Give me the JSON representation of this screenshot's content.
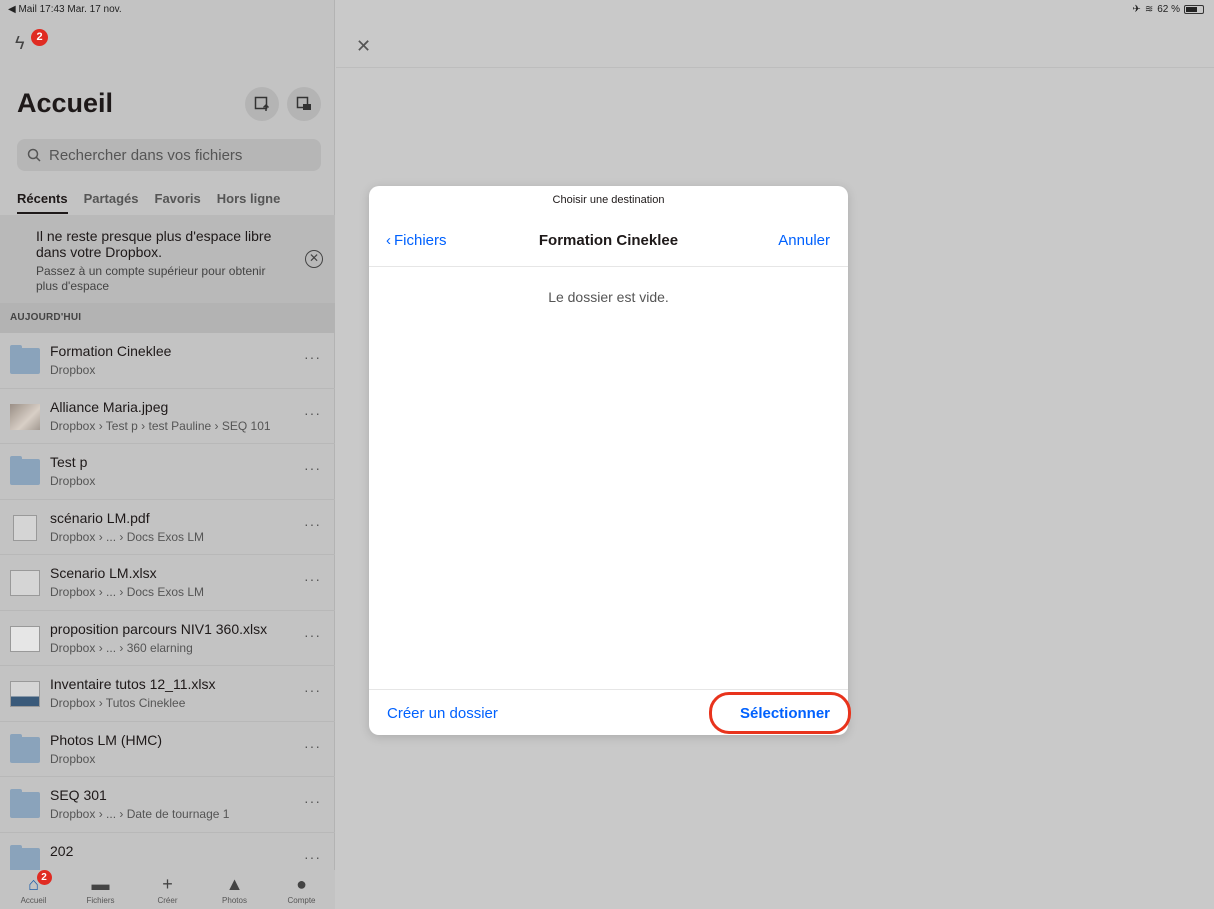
{
  "status_bar": {
    "back_app": "◀ Mail",
    "time": "17:43",
    "date": "Mar. 17 nov.",
    "battery": "62 %"
  },
  "sidebar": {
    "notification_count": "2",
    "title": "Accueil",
    "search_placeholder": "Rechercher dans vos fichiers",
    "tabs": [
      "Récents",
      "Partagés",
      "Favoris",
      "Hors ligne"
    ],
    "banner": {
      "title": "Il ne reste presque plus d'espace libre dans votre Dropbox.",
      "subtitle": "Passez à un compte supérieur pour obtenir plus d'espace"
    },
    "section_label": "AUJOURD'HUI",
    "items": [
      {
        "name": "Formation Cineklee",
        "path": "Dropbox",
        "icon": "folder-icon"
      },
      {
        "name": "Alliance Maria.jpeg",
        "path": "Dropbox › Test p › test Pauline › SEQ 101",
        "icon": "image-thumbnail"
      },
      {
        "name": "Test p",
        "path": "Dropbox",
        "icon": "folder-icon"
      },
      {
        "name": "scénario LM.pdf",
        "path": "Dropbox › ... › Docs Exos LM",
        "icon": "pdf-thumbnail"
      },
      {
        "name": "Scenario LM.xlsx",
        "path": "Dropbox › ... › Docs Exos LM",
        "icon": "spreadsheet-thumbnail"
      },
      {
        "name": "proposition parcours NIV1 360.xlsx",
        "path": "Dropbox › ... › 360 elarning",
        "icon": "spreadsheet-thumbnail"
      },
      {
        "name": "Inventaire tutos 12_11.xlsx",
        "path": "Dropbox › Tutos Cineklee",
        "icon": "spreadsheet-thumbnail"
      },
      {
        "name": "Photos LM (HMC)",
        "path": "Dropbox",
        "icon": "shared-folder-icon"
      },
      {
        "name": "SEQ 301",
        "path": "Dropbox › ... › Date de tournage 1",
        "icon": "folder-icon"
      },
      {
        "name": "202",
        "path": "",
        "icon": "folder-icon"
      }
    ],
    "more_label": "···",
    "tab_bar": [
      {
        "label": "Accueil",
        "icon": "home-icon",
        "badge": "2"
      },
      {
        "label": "Fichiers",
        "icon": "folder-icon"
      },
      {
        "label": "Créer",
        "icon": "plus-icon"
      },
      {
        "label": "Photos",
        "icon": "photos-icon"
      },
      {
        "label": "Compte",
        "icon": "account-icon"
      }
    ]
  },
  "modal": {
    "subtitle": "Choisir une destination",
    "back_label": "Fichiers",
    "title": "Formation Cineklee",
    "cancel_label": "Annuler",
    "empty_message": "Le dossier est vide.",
    "create_folder_label": "Créer un dossier",
    "select_label": "Sélectionner",
    "accent_color": "#0061fe",
    "highlight_color": "#e8331c"
  }
}
